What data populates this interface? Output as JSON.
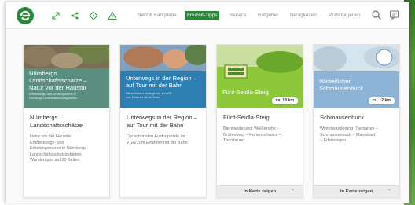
{
  "nav": {
    "items": [
      "Netz & Fahrpläne",
      "Freizeit-Tipps",
      "Service",
      "Ratgeber",
      "Neuigkeiten",
      "VGN für jeden"
    ],
    "active_index": 1
  },
  "icons": {
    "logo": "vgn-logo-icon",
    "tools": [
      "expand-icon",
      "share-icon",
      "tag-icon",
      "warning-icon"
    ],
    "search": "search-icon",
    "chat": "chat-icon"
  },
  "cards": [
    {
      "img_title_1": "Nürnbergs",
      "img_title_2": "Landschaftsschätze –",
      "img_title_3": "Natur vor der Haustür",
      "img_sub_1": "Entdeckungs- und Erholungstouren in",
      "img_sub_2": "Nürnbergs Landschaftsschutzgebieten",
      "title_1": "Nürnbergs",
      "title_2": "Landschaftsschätze",
      "desc": [
        "Natur vor der Haustür:",
        "Entdeckungs- und",
        "Erholungstouren in Nürnbergs",
        "Landschaftsschutzgebieten.",
        "Wandertipps auf 90 Seiten"
      ],
      "km": "",
      "map_label": ""
    },
    {
      "img_title_1": "Unterwegs in der Region –",
      "img_title_2": "auf Tour mit der Bahn",
      "img_title_3": "",
      "img_sub_1": "Die schönsten Ausflugsziele im VGN",
      "img_sub_2": "zum Erfahren mit der Bahn",
      "title_1": "Unterwegs in der Region –",
      "title_2": "auf Tour mit der Bahn",
      "desc": [
        "Die schönsten Ausflugsziele im",
        "VGN zum Erfahren mit der Bahn"
      ],
      "km": "",
      "map_label": ""
    },
    {
      "img_title_1": "Fünf-Seidla-Steig",
      "img_title_2": "",
      "img_title_3": "",
      "img_sub_1": "",
      "img_sub_2": "",
      "title_1": "Fünf-Seidla-Steig",
      "title_2": "",
      "desc": [
        "Bierwanderung: Weißenohe –",
        "Gräfenberg – Hohenschwarz –",
        "Thuisbrunn"
      ],
      "km": "ca. 18 km",
      "map_label": "In Karte zeigen"
    },
    {
      "img_title_1": "Winterlicher",
      "img_title_2": "Schmausenbuck",
      "img_title_3": "",
      "img_sub_1": "",
      "img_sub_2": "",
      "title_1": "Schmausenbuck",
      "title_2": "",
      "desc": [
        "Winterwanderung: Tiergarten –",
        "Schmausenbuck – Mainsbach",
        "– Erlenstegen"
      ],
      "km": "ca. 12 km",
      "map_label": "In Karte zeigen"
    }
  ],
  "colors": {
    "brand_green": "#2a8a3a",
    "card1": "#5b8f7e",
    "card2": "#2c7fb3",
    "card3": "#8cc83a",
    "card4": "#a8c6e0"
  }
}
